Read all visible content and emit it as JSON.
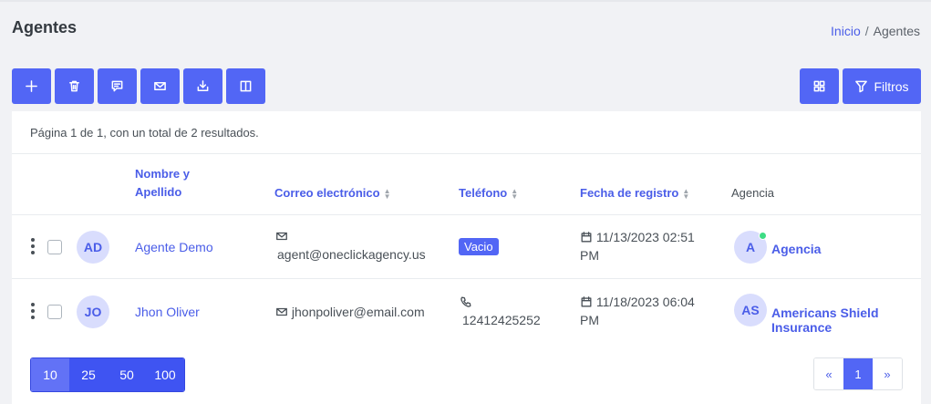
{
  "page": {
    "title": "Agentes"
  },
  "breadcrumb": {
    "home": "Inicio",
    "separator": "/",
    "current": "Agentes"
  },
  "toolbar": {
    "buttons": [
      {
        "icon": "plus-icon"
      },
      {
        "icon": "trash-icon"
      },
      {
        "icon": "comment-icon"
      },
      {
        "icon": "mail-icon"
      },
      {
        "icon": "download-icon"
      },
      {
        "icon": "columns-icon"
      }
    ],
    "grid_icon": "grid-icon",
    "filters_label": "Filtros"
  },
  "summary": "Página 1 de 1, con un total de 2 resultados.",
  "table": {
    "headers": {
      "name_line1": "Nombre y",
      "name_line2": "Apellido",
      "email": "Correo electrónico",
      "phone": "Teléfono",
      "date": "Fecha de registro",
      "agency": "Agencia"
    },
    "rows": [
      {
        "initials": "AD",
        "name": "Agente Demo",
        "email": "agent@oneclickagency.us",
        "phone": "",
        "phone_badge": "Vacio",
        "date_line1": "11/13/2023 02:51",
        "date_line2": "PM",
        "agency_initials": "A",
        "agency_line1": "Agencia",
        "agency_line2": ""
      },
      {
        "initials": "JO",
        "name": "Jhon Oliver",
        "email": "jhonpoliver@email.com",
        "phone": "12412425252",
        "phone_badge": "",
        "date_line1": "11/18/2023 06:04",
        "date_line2": "PM",
        "agency_initials": "AS",
        "agency_line1": "Americans Shield",
        "agency_line2": "Insurance"
      }
    ]
  },
  "page_sizes": [
    "10",
    "25",
    "50",
    "100"
  ],
  "pagination": {
    "prev": "«",
    "current": "1",
    "next": "»"
  },
  "colors": {
    "primary": "#5266f5",
    "link": "#4a5de8",
    "online": "#3ddc84"
  }
}
